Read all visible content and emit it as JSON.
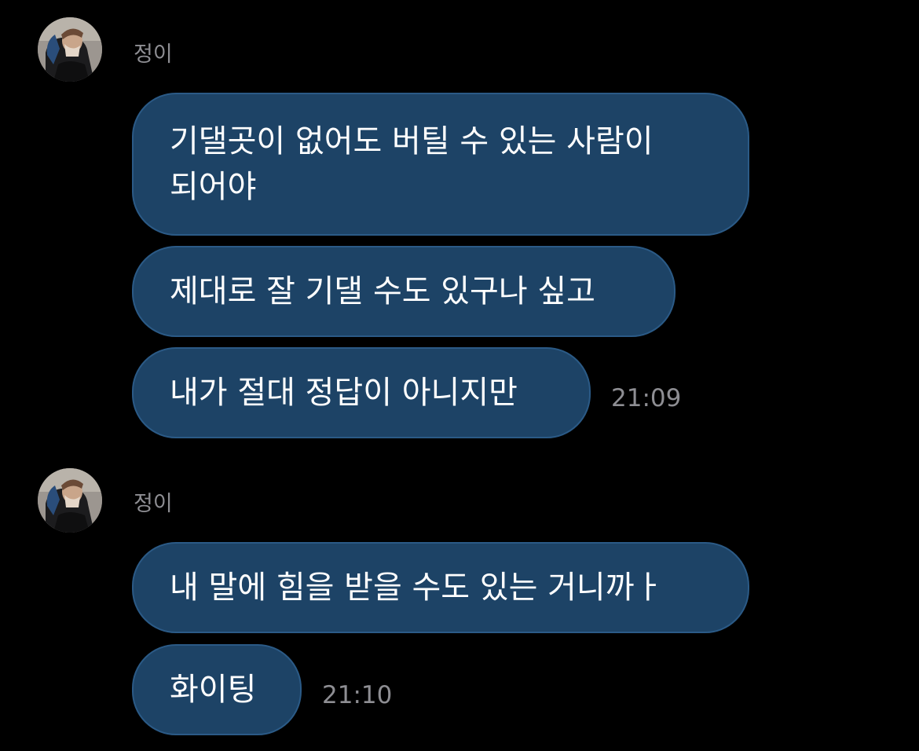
{
  "colors": {
    "background": "#000000",
    "bubble": "#1d4366",
    "bubble_border": "#2b5a86",
    "meta_text": "#8e8e93",
    "message_text": "#ffffff"
  },
  "groups": [
    {
      "sender": "정이",
      "avatar_icon": "profile-photo",
      "time": "21:09",
      "messages": [
        {
          "line1": "기댈곳이 없어도 버틸 수 있는 사람이",
          "line2": "되어야"
        },
        {
          "line1": "제대로 잘 기댈 수도 있구나 싶고"
        },
        {
          "line1": "내가 절대 정답이 아니지만"
        }
      ]
    },
    {
      "sender": "정이",
      "avatar_icon": "profile-photo",
      "time": "21:10",
      "messages": [
        {
          "line1": "내 말에 힘을 받을 수도 있는 거니까ㅏ"
        },
        {
          "line1": "화이팅"
        }
      ]
    }
  ]
}
